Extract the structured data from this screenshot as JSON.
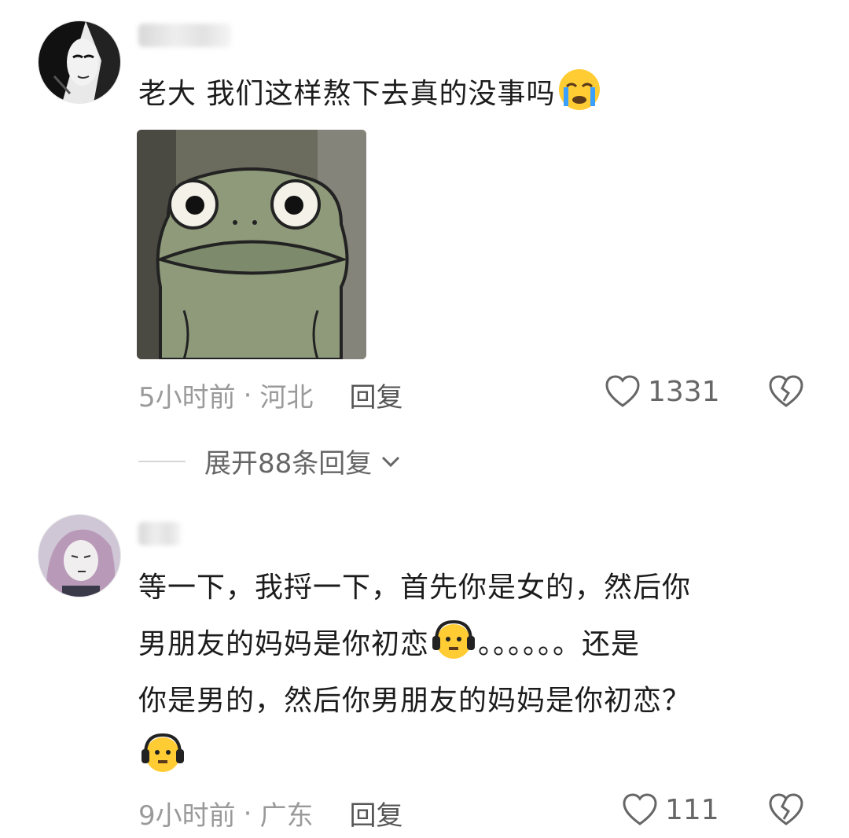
{
  "comments": [
    {
      "text": "老大 我们这样熬下去真的没事吗",
      "meta": {
        "time": "5小时前",
        "sep": "·",
        "location": "河北",
        "reply": "回复"
      },
      "likes": "1331",
      "expand": "展开88条回复",
      "emoji": "crying-face",
      "image": "frog-meme"
    },
    {
      "lines": [
        "等一下，我捋一下，首先你是女的，然后你",
        "男朋友的妈妈是你初恋",
        "。。。。。。还是",
        "你是男的，然后你男朋友的妈妈是你初恋？"
      ],
      "meta": {
        "time": "9小时前",
        "sep": "·",
        "location": "广东",
        "reply": "回复"
      },
      "likes": "111",
      "emoji": "headphone-frown-face"
    }
  ],
  "colors": {
    "text": "#1c1c1c",
    "meta": "#9a9a9a",
    "icon": "#666666"
  }
}
